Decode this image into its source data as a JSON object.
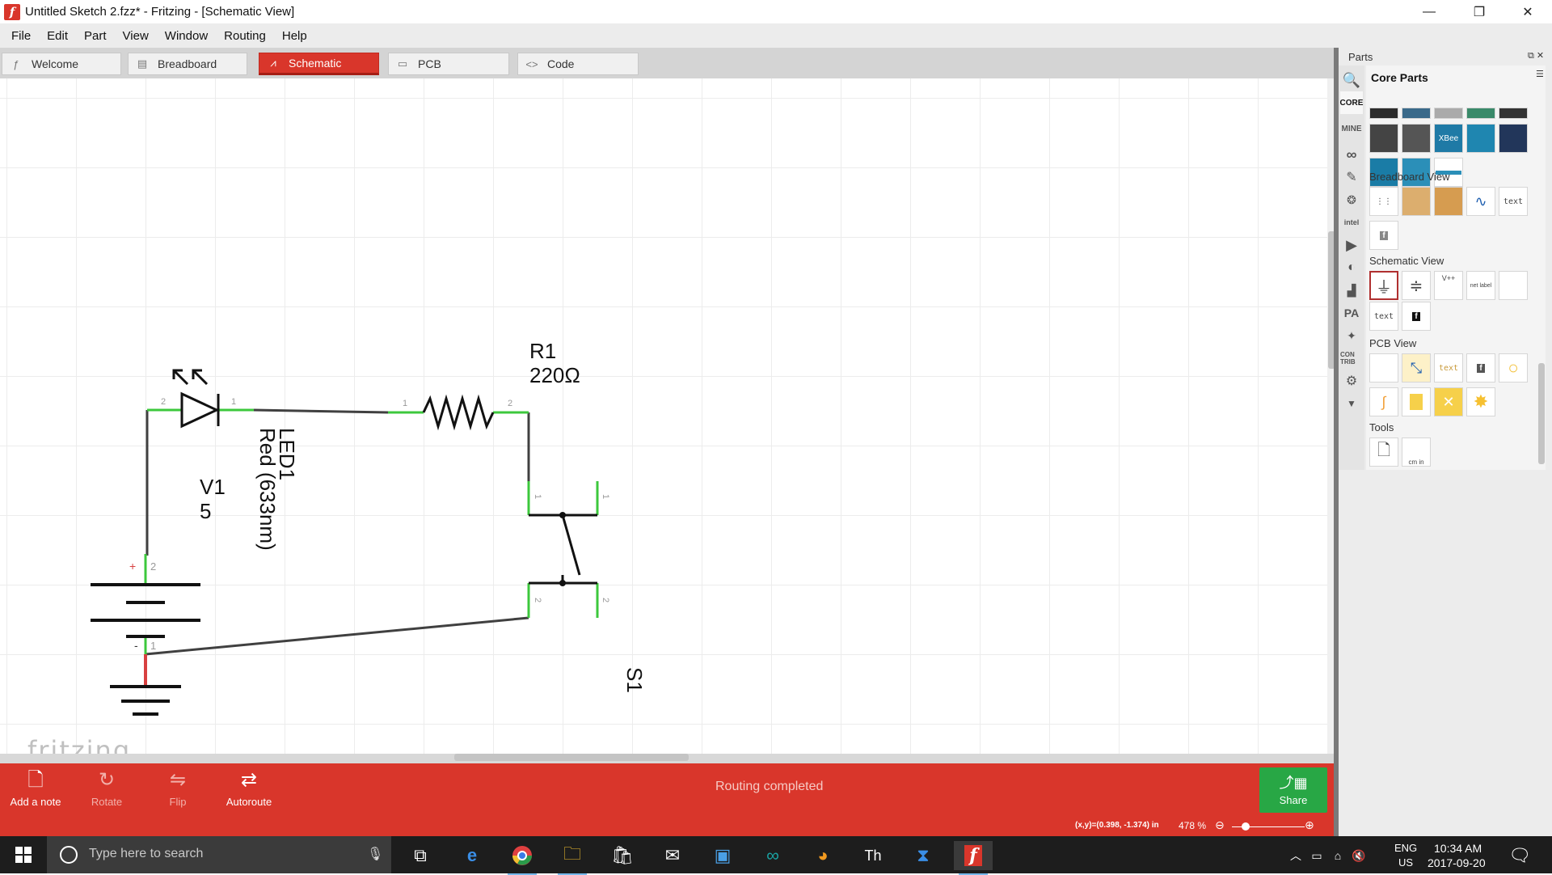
{
  "window": {
    "title": "Untitled Sketch 2.fzz* - Fritzing - [Schematic View]",
    "minimize": "—",
    "restore": "❐",
    "close": "✕"
  },
  "menu": [
    "File",
    "Edit",
    "Part",
    "View",
    "Window",
    "Routing",
    "Help"
  ],
  "tabs": [
    {
      "label": "Welcome",
      "icon": "fritzing-f-icon"
    },
    {
      "label": "Breadboard",
      "icon": "breadboard-icon"
    },
    {
      "label": "Schematic",
      "icon": "schematic-wave-icon",
      "active": true
    },
    {
      "label": "PCB",
      "icon": "pcb-icon"
    },
    {
      "label": "Code",
      "icon": "code-brackets-icon"
    }
  ],
  "schematic": {
    "led": {
      "name": "LED1",
      "value": "Red (633nm)",
      "pin_a": "2",
      "pin_k": "1"
    },
    "resistor": {
      "name": "R1",
      "value": "220Ω",
      "pin1": "1",
      "pin2": "2"
    },
    "battery": {
      "name": "V1",
      "value": "5",
      "plus": "+",
      "minus": "-",
      "pin_plus": "2",
      "pin_minus": "1"
    },
    "switch": {
      "name": "S1",
      "pins": [
        "1",
        "1",
        "2",
        "2"
      ]
    }
  },
  "watermark": "fritzing",
  "toolbar": {
    "add_note": "Add a note",
    "rotate": "Rotate",
    "flip": "Flip",
    "autoroute": "Autoroute",
    "status": "Routing completed",
    "share": "Share"
  },
  "statusbar": {
    "coords": "(x,y)=(0.398, -1.374) in",
    "zoom": "478 %",
    "zoom_level_percent": 478
  },
  "parts": {
    "panel_title": "Parts",
    "bin_title": "Core Parts",
    "bins": [
      "CORE",
      "MINE"
    ],
    "sections": [
      "Breadboard View",
      "Schematic View",
      "PCB View",
      "Tools"
    ],
    "text_part": "text",
    "net_label": "net label",
    "vcc_label": "V++",
    "ruler_label": "cm in"
  },
  "taskbar": {
    "search_placeholder": "Type here to search",
    "lang": "ENG",
    "region": "US",
    "time": "10:34 AM",
    "date": "2017-09-20"
  },
  "colors": {
    "accent": "#d9362b",
    "share": "#28a745",
    "wire": "#404040",
    "pin_ok": "#3cc83c",
    "pin_err": "#d84040"
  }
}
